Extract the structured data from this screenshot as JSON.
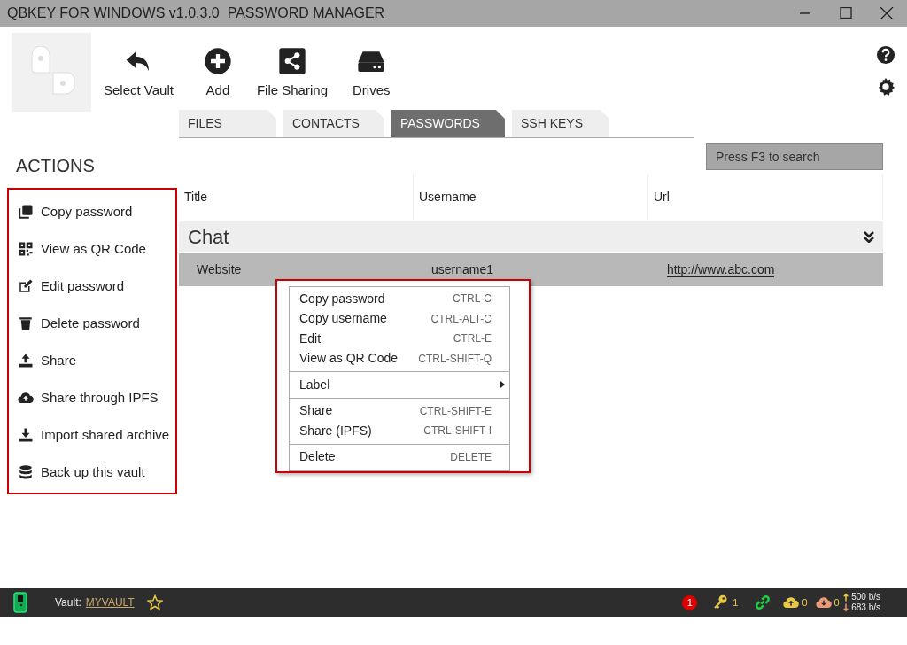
{
  "window": {
    "title": "QBKEY FOR WINDOWS v1.0.3.0  PASSWORD MANAGER"
  },
  "toolbar": [
    {
      "label": "Select Vault"
    },
    {
      "label": "Add"
    },
    {
      "label": "File Sharing"
    },
    {
      "label": "Drives"
    }
  ],
  "tabs": [
    {
      "label": "FILES",
      "selected": false
    },
    {
      "label": "CONTACTS",
      "selected": false
    },
    {
      "label": "PASSWORDS",
      "selected": true
    },
    {
      "label": "SSH KEYS",
      "selected": false
    }
  ],
  "search": {
    "placeholder": "Press F3 to search"
  },
  "actions": {
    "heading": "ACTIONS",
    "items": [
      {
        "label": "Copy password"
      },
      {
        "label": "View as QR Code"
      },
      {
        "label": "Edit password"
      },
      {
        "label": "Delete password"
      },
      {
        "label": "Share"
      },
      {
        "label": "Share through IPFS"
      },
      {
        "label": "Import shared archive"
      },
      {
        "label": "Back up this vault"
      }
    ]
  },
  "table": {
    "columns": [
      "Title",
      "Username",
      "Url"
    ],
    "groups": [
      {
        "name": "Chat",
        "rows": [
          {
            "title": "Website",
            "username": "username1",
            "url": "http://www.abc.com",
            "selected": true
          }
        ]
      }
    ]
  },
  "context_menu": [
    {
      "kind": "item",
      "label": "Copy password",
      "shortcut": "CTRL-C"
    },
    {
      "kind": "item",
      "label": "Copy username",
      "shortcut": "CTRL-ALT-C"
    },
    {
      "kind": "item",
      "label": "Edit",
      "shortcut": "CTRL-E"
    },
    {
      "kind": "item",
      "label": "View as QR Code",
      "shortcut": "CTRL-SHIFT-Q"
    },
    {
      "kind": "separator"
    },
    {
      "kind": "submenu",
      "label": "Label"
    },
    {
      "kind": "separator"
    },
    {
      "kind": "item",
      "label": "Share",
      "shortcut": "CTRL-SHIFT-E"
    },
    {
      "kind": "item",
      "label": "Share (IPFS)",
      "shortcut": "CTRL-SHIFT-I"
    },
    {
      "kind": "separator"
    },
    {
      "kind": "item",
      "label": "Delete",
      "shortcut": "DELETE"
    }
  ],
  "status_bar": {
    "vault_label": "Vault:",
    "vault_name": "MYVAULT",
    "alerts": "1",
    "keys": "1",
    "uploads": "0",
    "downloads": "0",
    "up_rate": "500 b/s",
    "down_rate": "683 b/s"
  }
}
